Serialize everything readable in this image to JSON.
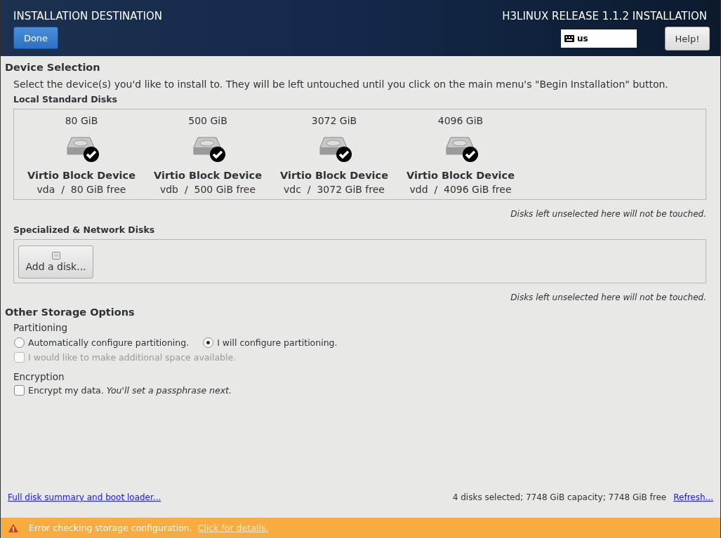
{
  "header": {
    "title": "INSTALLATION DESTINATION",
    "done_button": "Done",
    "product": "H3LINUX RELEASE 1.1.2 INSTALLATION",
    "keyboard_layout": "us",
    "help_button": "Help!"
  },
  "device_selection": {
    "heading": "Device Selection",
    "intro": "Select the device(s) you'd like to install to.  They will be left untouched until you click on the main menu's \"Begin Installation\" button.",
    "local_disks": {
      "heading": "Local Standard Disks",
      "disks": [
        {
          "size": "80 GiB",
          "name": "Virtio Block Device",
          "details": "vda  /  80 GiB free",
          "selected": true
        },
        {
          "size": "500 GiB",
          "name": "Virtio Block Device",
          "details": "vdb  /  500 GiB free",
          "selected": true
        },
        {
          "size": "3072 GiB",
          "name": "Virtio Block Device",
          "details": "vdc  /  3072 GiB free",
          "selected": true
        },
        {
          "size": "4096 GiB",
          "name": "Virtio Block Device",
          "details": "vdd  /  4096 GiB free",
          "selected": true
        }
      ],
      "note": "Disks left unselected here will not be touched."
    },
    "network_disks": {
      "heading": "Specialized & Network Disks",
      "add_button": "Add a disk...",
      "note": "Disks left unselected here will not be touched."
    }
  },
  "other_storage": {
    "heading": "Other Storage Options",
    "partitioning": {
      "heading": "Partitioning",
      "options": [
        {
          "label": "Automatically configure partitioning.",
          "selected": false
        },
        {
          "label": "I will configure partitioning.",
          "selected": true
        }
      ],
      "extra_space": {
        "label": "I would like to make additional space available.",
        "checked": false,
        "disabled": true
      }
    },
    "encryption": {
      "heading": "Encryption",
      "checkbox": {
        "label": "Encrypt my data. *You'll set a passphrase next.*",
        "checked": false,
        "disabled": false
      }
    }
  },
  "footer": {
    "summary_link": "Full disk summary and boot loader...",
    "status": "4 disks selected; 7748 GiB capacity; 7748 GiB free",
    "refresh_link": "Refresh..."
  },
  "status_bar": {
    "message": "Error checking storage configuration.",
    "link": "Click for details."
  }
}
